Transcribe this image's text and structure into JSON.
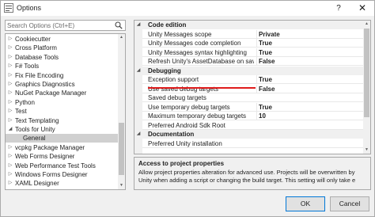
{
  "window": {
    "title": "Options",
    "help_glyph": "?",
    "close_glyph": "✕",
    "icon": "options-app-icon"
  },
  "search": {
    "placeholder": "Search Options (Ctrl+E)",
    "icon": "search-icon"
  },
  "tree": {
    "items": [
      {
        "label": "Cookiecutter",
        "arrow": "▷",
        "child": false,
        "selected": false
      },
      {
        "label": "Cross Platform",
        "arrow": "▷",
        "child": false,
        "selected": false
      },
      {
        "label": "Database Tools",
        "arrow": "▷",
        "child": false,
        "selected": false
      },
      {
        "label": "F# Tools",
        "arrow": "▷",
        "child": false,
        "selected": false
      },
      {
        "label": "Fix File Encoding",
        "arrow": "▷",
        "child": false,
        "selected": false
      },
      {
        "label": "Graphics Diagnostics",
        "arrow": "▷",
        "child": false,
        "selected": false
      },
      {
        "label": "NuGet Package Manager",
        "arrow": "▷",
        "child": false,
        "selected": false
      },
      {
        "label": "Python",
        "arrow": "▷",
        "child": false,
        "selected": false
      },
      {
        "label": "Test",
        "arrow": "▷",
        "child": false,
        "selected": false
      },
      {
        "label": "Text Templating",
        "arrow": "▷",
        "child": false,
        "selected": false
      },
      {
        "label": "Tools for Unity",
        "arrow": "◢",
        "child": false,
        "selected": false
      },
      {
        "label": "General",
        "arrow": "",
        "child": true,
        "selected": true
      },
      {
        "label": "vcpkg Package Manager",
        "arrow": "▷",
        "child": false,
        "selected": false
      },
      {
        "label": "Web Forms Designer",
        "arrow": "▷",
        "child": false,
        "selected": false
      },
      {
        "label": "Web Performance Test Tools",
        "arrow": "▷",
        "child": false,
        "selected": false
      },
      {
        "label": "Windows Forms Designer",
        "arrow": "▷",
        "child": false,
        "selected": false
      },
      {
        "label": "XAML Designer",
        "arrow": "▷",
        "child": false,
        "selected": false
      }
    ]
  },
  "grid": {
    "rows": [
      {
        "kind": "category",
        "label": "Code edition",
        "arrow": "◢"
      },
      {
        "kind": "property",
        "name": "Unity Messages scope",
        "value": "Private"
      },
      {
        "kind": "property",
        "name": "Unity Messages code completion",
        "value": "True"
      },
      {
        "kind": "property",
        "name": "Unity Messages syntax highlighting",
        "value": "True"
      },
      {
        "kind": "property",
        "name": "Refresh Unity's AssetDatabase on save",
        "value": "False"
      },
      {
        "kind": "category",
        "label": "Debugging",
        "arrow": "◢"
      },
      {
        "kind": "property",
        "name": "Exception support",
        "value": "True"
      },
      {
        "kind": "property",
        "name": "Use saved debug targets",
        "value": "False"
      },
      {
        "kind": "property",
        "name": "Saved debug targets",
        "value": ""
      },
      {
        "kind": "property",
        "name": "Use temporary debug targets",
        "value": "True"
      },
      {
        "kind": "property",
        "name": "Maximum temporary debug targets",
        "value": "10"
      },
      {
        "kind": "property",
        "name": "Preferred Android Sdk Root",
        "value": ""
      },
      {
        "kind": "category",
        "label": "Documentation",
        "arrow": "◢"
      },
      {
        "kind": "property",
        "name": "Preferred Unity installation",
        "value": ""
      }
    ],
    "highlight_color": "#e01c1c"
  },
  "description": {
    "title": "Access to project properties",
    "text": "Allow project properties alteration for advanced use. Projects will be overwritten by Unity when adding a script or changing the build target. This setting will only take e"
  },
  "buttons": {
    "ok": "OK",
    "cancel": "Cancel"
  },
  "colors": {
    "selection": "#d0d0d0",
    "ok_border": "#0078d7"
  }
}
